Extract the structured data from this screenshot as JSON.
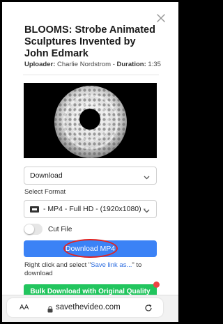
{
  "video": {
    "title": "BLOOMS: Strobe Animated Sculptures Invented by John Edmark",
    "uploader_label": "Uploader:",
    "uploader": "Charlie Nordstrom",
    "separator": "-",
    "duration_label": "Duration:",
    "duration": "1:35"
  },
  "download_select": {
    "value": "Download"
  },
  "format": {
    "label": "Select Format",
    "value": "- MP4 - Full HD - (1920x1080) -"
  },
  "cut_file": {
    "label": "Cut File",
    "enabled": false
  },
  "download_button": {
    "label": "Download MP4"
  },
  "hint": {
    "before": "Right click and select \"",
    "link": "Save link as...",
    "after": "\" to download"
  },
  "bulk_button": {
    "label": "Bulk Download with Original Quality"
  },
  "browser_bar": {
    "text_size_label": "AA",
    "url": "savethevideo.com"
  },
  "icons": [
    "close-icon",
    "chevron-down-icon",
    "film-icon",
    "lock-icon",
    "reload-icon"
  ],
  "colors": {
    "primary": "#3b82f6",
    "success": "#22c55e",
    "highlight": "#e02424"
  }
}
